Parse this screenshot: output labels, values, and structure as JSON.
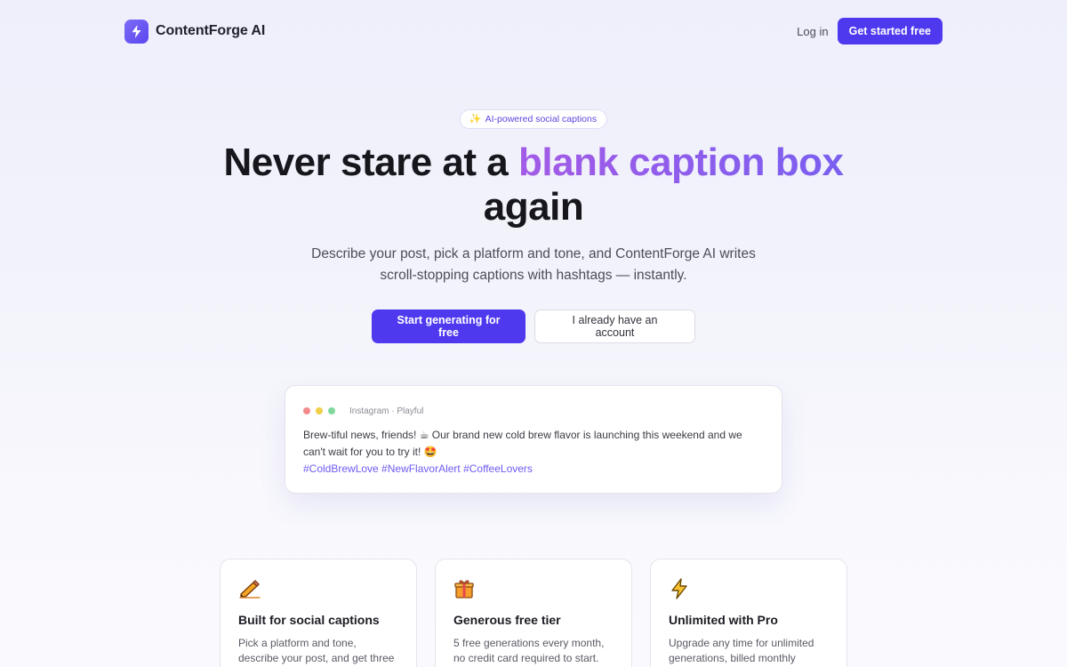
{
  "nav": {
    "brand": "ContentForge AI",
    "logo_icon": "lightning-bolt-icon",
    "login_label": "Log in",
    "cta_label": "Get started free"
  },
  "hero": {
    "badge_icon": "sparkles-icon",
    "badge_text": "AI-powered social captions",
    "headline_part1": "Never stare at a ",
    "headline_accent": "blank caption box",
    "headline_part2": "again",
    "subtext": "Describe your post, pick a platform and tone, and ContentForge AI writes scroll-stopping captions with hashtags — instantly.",
    "primary_cta": "Start generating for free",
    "secondary_cta": "I already have an account"
  },
  "preview": {
    "meta": "Instagram · Playful",
    "caption": "Brew-tiful news, friends! ☕ Our brand new cold brew flavor is launching this weekend and we can't wait for you to try it! 🤩",
    "hashtags": "#ColdBrewLove #NewFlavorAlert #CoffeeLovers",
    "dot_colors": [
      "#f28b8b",
      "#f2cf4a",
      "#7fd89a"
    ]
  },
  "features": [
    {
      "icon": "pencil-icon",
      "title": "Built for social captions",
      "desc": "Pick a platform and tone, describe your post, and get three"
    },
    {
      "icon": "gift-icon",
      "title": "Generous free tier",
      "desc": "5 free generations every month, no credit card required to start."
    },
    {
      "icon": "lightning-icon",
      "title": "Unlimited with Pro",
      "desc": "Upgrade any time for unlimited generations, billed monthly"
    }
  ],
  "colors": {
    "brand": "#4e39ef",
    "accent_gradient_start": "#a35be6",
    "accent_gradient_end": "#7a5ff0",
    "hashtag": "#6d5bf0"
  }
}
